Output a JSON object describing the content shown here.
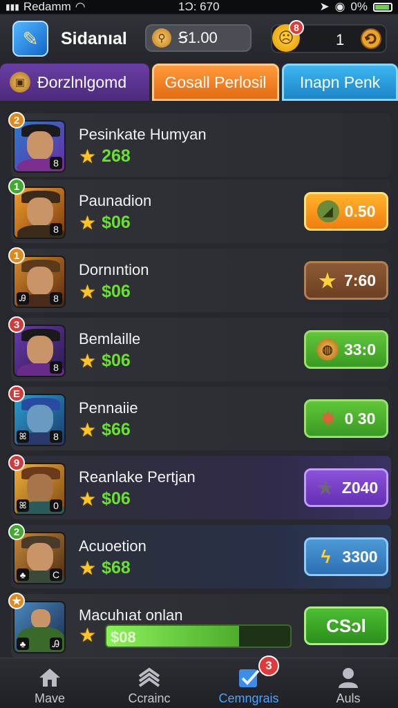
{
  "status_bar": {
    "carrier": "Redamm",
    "time": "1Ɔ: 670",
    "battery": "0%"
  },
  "header": {
    "title": "Sidanıal",
    "coins": "Ꞩ1.00",
    "energy_badge": "8",
    "energy_count": "1"
  },
  "tabs": [
    {
      "label": "Ðorzlnlgomd"
    },
    {
      "label": "Gosall Perlosil"
    },
    {
      "label": "Inapn Penk"
    }
  ],
  "rows": [
    {
      "rank": "2",
      "rank_color": "#e08a1e",
      "name": "Pesinkate Humyan",
      "score": "268",
      "level": "8",
      "left_tag": "",
      "reward": "",
      "reward_style": "none"
    },
    {
      "rank": "1",
      "rank_color": "#3faa2b",
      "name": "Paunadion",
      "score": "$06",
      "level": "8",
      "left_tag": "",
      "reward": "0.50",
      "reward_style": "orange",
      "reward_icon": "hat-icon"
    },
    {
      "rank": "1",
      "rank_color": "#e08a1e",
      "name": "Dornıntion",
      "score": "$06",
      "level": "8",
      "left_tag": "Ꭿ",
      "reward": "7:60",
      "reward_style": "brown",
      "reward_icon": "star-icon"
    },
    {
      "rank": "3",
      "rank_color": "#d33a3a",
      "name": "Bemlaille",
      "score": "$06",
      "level": "8",
      "left_tag": "",
      "reward": "33:0",
      "reward_style": "green",
      "reward_icon": "ball-icon"
    },
    {
      "rank": "E",
      "rank_color": "#d33a3a",
      "name": "Pennaiie",
      "score": "$66",
      "level": "8",
      "left_tag": "ꕤ",
      "reward": "0 30",
      "reward_style": "green",
      "reward_icon": "starburst-icon"
    },
    {
      "rank": "9",
      "rank_color": "#d33a3a",
      "name": "Reanlake Pertjan",
      "score": "$06",
      "level": "0",
      "left_tag": "ꕤ",
      "reward": "Z040",
      "reward_style": "purple",
      "reward_icon": "gray-star-icon"
    },
    {
      "rank": "2",
      "rank_color": "#3faa2b",
      "name": "Acuoetion",
      "score": "$68",
      "level": "C",
      "left_tag": "♣",
      "reward": "3300",
      "reward_style": "blue",
      "reward_icon": "bolt-icon"
    },
    {
      "rank": "★",
      "rank_color": "#e08a1e",
      "name": "Macuhıat onlan",
      "score": "$08",
      "level": "Ꭿ",
      "left_tag": "♣",
      "reward": "CSɔl",
      "reward_style": "green-outline",
      "progress": 0.72
    }
  ],
  "bottom_nav": [
    {
      "label": "Mave",
      "icon": "house-icon"
    },
    {
      "label": "Ccrainc",
      "icon": "layers-icon"
    },
    {
      "label": "Cemngrais",
      "icon": "checkbox-icon",
      "badge": "3",
      "active": true
    },
    {
      "label": "Auls",
      "icon": "person-icon"
    }
  ]
}
